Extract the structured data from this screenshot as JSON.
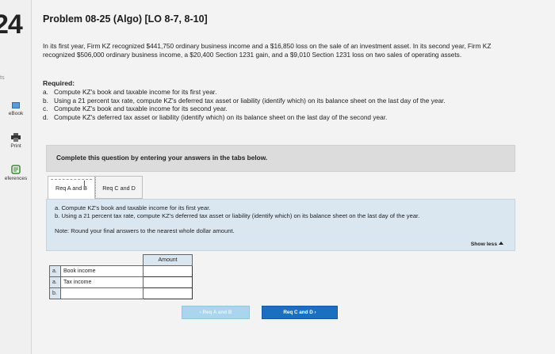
{
  "question_number": "24",
  "sidebar": {
    "points_label": "ts",
    "ebook_label": "eBook",
    "print_label": "Print",
    "references_label": "eferences"
  },
  "problem": {
    "title": "Problem 08-25 (Algo) [LO 8-7, 8-10]",
    "intro": "In its first year, Firm KZ recognized $441,750 ordinary business income and a $16,850 loss on the sale of an investment asset. In its second year, Firm KZ recognized $506,000 ordinary business income, a $20,400 Section 1231 gain, and a $9,010 Section 1231 loss on two sales of operating assets."
  },
  "required": {
    "heading": "Required:",
    "items": [
      {
        "letter": "a.",
        "text": "Compute KZ's book and taxable income for its first year."
      },
      {
        "letter": "b.",
        "text": "Using a 21 percent tax rate, compute KZ's deferred tax asset or liability (identify which) on its balance sheet on the last day of the year."
      },
      {
        "letter": "c.",
        "text": "Compute KZ's book and taxable income for its second year."
      },
      {
        "letter": "d.",
        "text": "Compute KZ's deferred tax asset or liability (identify which) on its balance sheet on the last day of the second year."
      }
    ]
  },
  "instruction": "Complete this question by entering your answers in the tabs below.",
  "tabs": [
    {
      "label": "Req A and B"
    },
    {
      "label": "Req C and D"
    }
  ],
  "panel": {
    "line_a": "a. Compute KZ's book and taxable income for its first year.",
    "line_b": "b. Using a 21 percent tax rate, compute KZ's deferred tax asset or liability (identify which) on its balance sheet on the last day of the year.",
    "note": "Note: Round your final answers to the nearest whole dollar amount.",
    "show_less": "Show less"
  },
  "table": {
    "column_header": "Amount",
    "rows": [
      {
        "letter": "a.",
        "label": "Book income",
        "value": ""
      },
      {
        "letter": "a.",
        "label": "Tax income",
        "value": ""
      },
      {
        "letter": "b.",
        "label": "",
        "value": ""
      }
    ]
  },
  "nav": {
    "prev_label": "Req A and B",
    "next_label": "Req C and D"
  }
}
